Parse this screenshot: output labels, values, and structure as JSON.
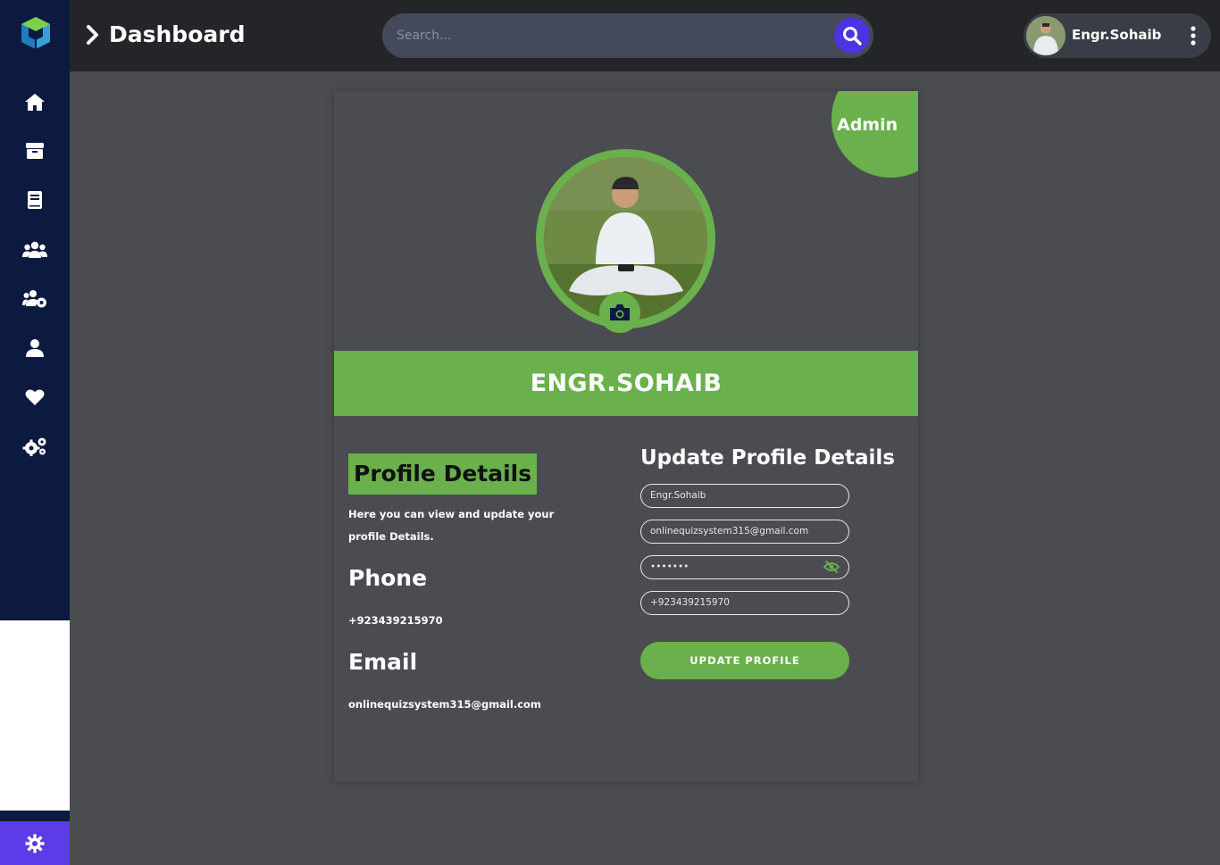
{
  "header": {
    "breadcrumb": "Dashboard",
    "search_placeholder": "Search...",
    "user_name": "Engr.Sohaib"
  },
  "sidebar": {
    "items": [
      {
        "icon": "home-icon"
      },
      {
        "icon": "box-icon"
      },
      {
        "icon": "book-icon"
      },
      {
        "icon": "users-icon"
      },
      {
        "icon": "users-cog-icon"
      },
      {
        "icon": "user-icon"
      },
      {
        "icon": "heart-icon"
      },
      {
        "icon": "cogs-icon"
      }
    ],
    "settings_icon": "gear-icon"
  },
  "profile": {
    "role_badge": "Admin",
    "display_name": "ENGR.SOHAIB",
    "details_title": "Profile Details",
    "details_desc": "Here you can view and update your profile Details.",
    "phone_label": "Phone",
    "phone_value": "+923439215970",
    "email_label": "Email",
    "email_value": "onlinequizsystem315@gmail.com"
  },
  "update_form": {
    "title": "Update Profile Details",
    "name_value": "Engr.Sohaib",
    "email_value": "onlinequizsystem315@gmail.com",
    "password_value": "•••••••",
    "phone_value": "+923439215970",
    "submit_label": "UPDATE PROFILE"
  },
  "colors": {
    "accent_green": "#6ab04c",
    "sidebar_navy": "#0c1a40",
    "accent_purple": "#5b3ce8"
  }
}
